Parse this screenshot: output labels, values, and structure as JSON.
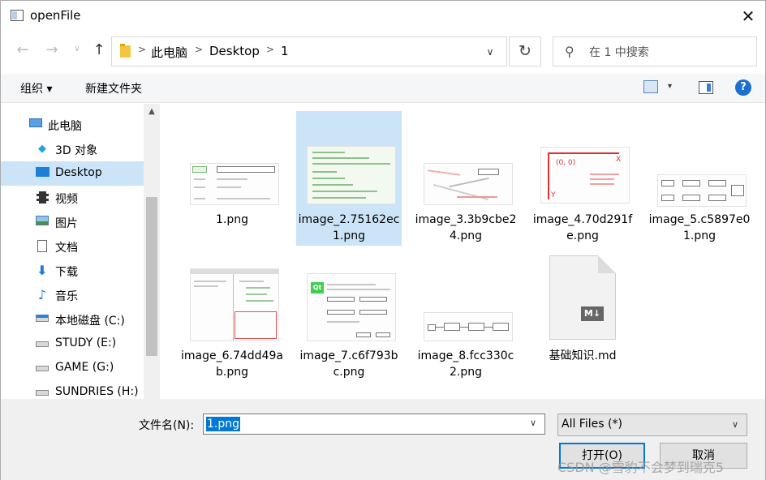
{
  "window": {
    "title": "openFile",
    "close_glyph": "✕"
  },
  "nav_buttons": {
    "back": "←",
    "forward": "→",
    "recent": "∨",
    "up": "↑",
    "refresh": "↻"
  },
  "address": {
    "crumbs": [
      "此电脑",
      "Desktop",
      "1"
    ],
    "separator": ">"
  },
  "search": {
    "placeholder": "在 1 中搜索"
  },
  "toolbar": {
    "organize": "组织 ▾",
    "new_folder": "新建文件夹",
    "view_dropdown": "▾",
    "help": "?"
  },
  "sidebar": {
    "items": [
      {
        "label": "此电脑",
        "icon": "computer-icon"
      },
      {
        "label": "3D 对象",
        "icon": "cube-icon"
      },
      {
        "label": "Desktop",
        "icon": "desktop-icon",
        "selected": true
      },
      {
        "label": "视频",
        "icon": "film-icon"
      },
      {
        "label": "图片",
        "icon": "picture-icon"
      },
      {
        "label": "文档",
        "icon": "document-icon"
      },
      {
        "label": "下载",
        "icon": "download-icon"
      },
      {
        "label": "音乐",
        "icon": "music-icon"
      },
      {
        "label": "本地磁盘 (C:)",
        "icon": "windows-drive-icon"
      },
      {
        "label": "STUDY (E:)",
        "icon": "drive-icon"
      },
      {
        "label": "GAME (G:)",
        "icon": "drive-icon"
      },
      {
        "label": "SUNDRIES (H:)",
        "icon": "drive-icon"
      }
    ]
  },
  "files": [
    {
      "name": "1.png",
      "selected": false
    },
    {
      "name": "image_2.75162ec1.png",
      "selected": true
    },
    {
      "name": "image_3.3b9cbe24.png",
      "selected": false
    },
    {
      "name": "image_4.70d291fe.png",
      "selected": false
    },
    {
      "name": "image_5.c5897e01.png",
      "selected": false
    },
    {
      "name": "image_6.74dd49ab.png",
      "selected": false
    },
    {
      "name": "image_7.c6f793bc.png",
      "selected": false
    },
    {
      "name": "image_8.fcc330c2.png",
      "selected": false
    },
    {
      "name": "基础知识.md",
      "selected": false
    }
  ],
  "thumb_text": {
    "img4_origin": "(0, 0)",
    "img4_x": "X",
    "img4_y": "Y",
    "img7_logo": "Qt",
    "md_badge": "M↓"
  },
  "bottom": {
    "filename_label": "文件名(N):",
    "filename_value": "1.png",
    "filter_value": "All Files (*)",
    "open_label": "打开(O)",
    "cancel_label": "取消",
    "dropdown_glyph": "∨"
  },
  "watermark": "CSDN @雪豹不会梦到瑞克5",
  "colors": {
    "accent": "#0078d7",
    "selection": "#cce4f7",
    "folder": "#f5c542"
  }
}
